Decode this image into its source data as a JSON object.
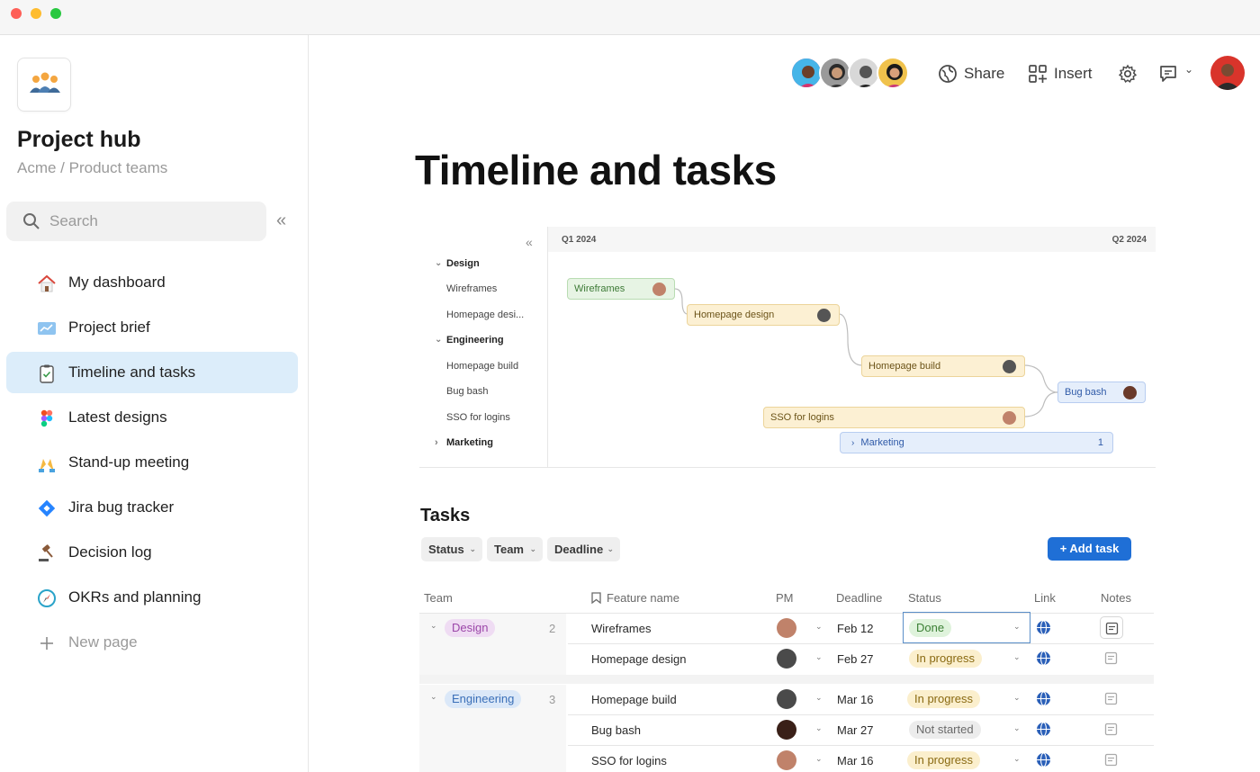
{
  "window": {
    "controls": [
      "close",
      "minimize",
      "maximize"
    ]
  },
  "sidebar": {
    "app_title": "Project hub",
    "breadcrumb": "Acme / Product teams",
    "search_placeholder": "Search",
    "items": [
      {
        "label": "My dashboard",
        "icon": "house-icon"
      },
      {
        "label": "Project brief",
        "icon": "chart-icon"
      },
      {
        "label": "Timeline and tasks",
        "icon": "clipboard-check-icon",
        "active": true
      },
      {
        "label": "Latest designs",
        "icon": "figma-icon"
      },
      {
        "label": "Stand-up meeting",
        "icon": "raised-hands-icon"
      },
      {
        "label": "Jira bug tracker",
        "icon": "jira-icon"
      },
      {
        "label": "Decision log",
        "icon": "gavel-icon"
      },
      {
        "label": "OKRs and planning",
        "icon": "compass-icon"
      },
      {
        "label": "New page",
        "icon": "plus-icon"
      }
    ]
  },
  "header": {
    "share_label": "Share",
    "insert_label": "Insert"
  },
  "page": {
    "title": "Timeline and tasks"
  },
  "timeline": {
    "quarters": [
      "Q1 2024",
      "Q2 2024"
    ],
    "rows": [
      {
        "label": "Design",
        "group": true
      },
      {
        "label": "Wireframes"
      },
      {
        "label": "Homepage desi..."
      },
      {
        "label": "Engineering",
        "group": true
      },
      {
        "label": "Homepage build"
      },
      {
        "label": "Bug bash"
      },
      {
        "label": "SSO for logins"
      },
      {
        "label": "Marketing",
        "group": true
      }
    ],
    "bars": {
      "wireframes": "Wireframes",
      "homepage_design": "Homepage design",
      "homepage_build": "Homepage build",
      "bug_bash": "Bug bash",
      "sso": "SSO for logins",
      "marketing": "Marketing",
      "marketing_count": "1"
    }
  },
  "tasks": {
    "title": "Tasks",
    "filters": [
      "Status",
      "Team",
      "Deadline"
    ],
    "add_label": "+ Add task",
    "columns": [
      "Team",
      "Feature name",
      "PM",
      "Deadline",
      "Status",
      "Link",
      "Notes"
    ],
    "groups": [
      {
        "team": "Design",
        "count": "2"
      },
      {
        "team": "Engineering",
        "count": "3"
      }
    ],
    "rows": [
      {
        "feature": "Wireframes",
        "deadline": "Feb 12",
        "status": "Done"
      },
      {
        "feature": "Homepage design",
        "deadline": "Feb 27",
        "status": "In progress"
      },
      {
        "feature": "Homepage build",
        "deadline": "Mar 16",
        "status": "In progress"
      },
      {
        "feature": "Bug bash",
        "deadline": "Mar 27",
        "status": "Not started"
      },
      {
        "feature": "SSO for logins",
        "deadline": "Mar 16",
        "status": "In progress"
      }
    ]
  },
  "colors": {
    "accent": "#1f6fd6",
    "active_nav": "#dcedfa"
  }
}
